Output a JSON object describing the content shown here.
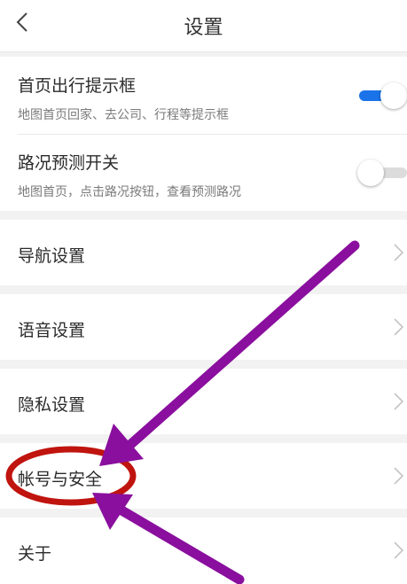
{
  "header": {
    "title": "设置",
    "back_icon": "chevron-left-icon"
  },
  "toggles": [
    {
      "title": "首页出行提示框",
      "subtitle": "地图首页回家、去公司、行程等提示框",
      "enabled": true
    },
    {
      "title": "路况预测开关",
      "subtitle": "地图首页，点击路况按钮，查看预测路况",
      "enabled": false
    }
  ],
  "menu": [
    {
      "label": "导航设置"
    },
    {
      "label": "语音设置"
    },
    {
      "label": "隐私设置"
    },
    {
      "label": "帐号与安全"
    },
    {
      "label": "关于"
    }
  ],
  "colors": {
    "toggle_on": "#1a73e8",
    "toggle_off": "#dcdcdc",
    "annotation_circle": "#c0140f",
    "annotation_arrow": "#8a0f9e"
  }
}
